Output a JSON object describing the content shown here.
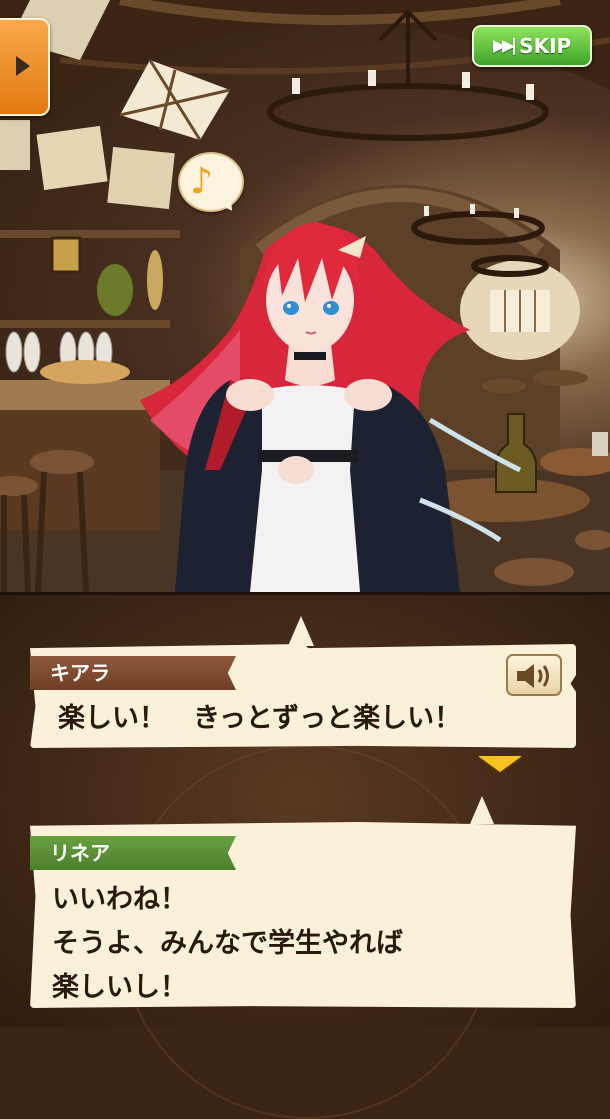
{
  "controls": {
    "menu_icon": "triangle-right-icon",
    "skip_icon": "fast-forward-icon",
    "skip_label": "SKIP",
    "bgm_icon": "music-note-icon",
    "voice_icon": "speaker-icon",
    "next_icon": "triangle-down-icon"
  },
  "scene": {
    "location": "tavern",
    "character": "red-haired-girl-portrait"
  },
  "dialogue": [
    {
      "speaker": "キアラ",
      "text": "楽しい！　きっとずっと楽しい！",
      "plate_color": "#7d4a2f"
    },
    {
      "speaker": "リネア",
      "text": "いいわね！\nそうよ、みんなで学生やれば\n楽しいし！",
      "plate_color": "#5a9036"
    }
  ],
  "colors": {
    "skip_green": "#4fb232",
    "menu_orange": "#f08a1e",
    "panel": "#fbf1d8",
    "next_arrow": "#f8c21e"
  }
}
